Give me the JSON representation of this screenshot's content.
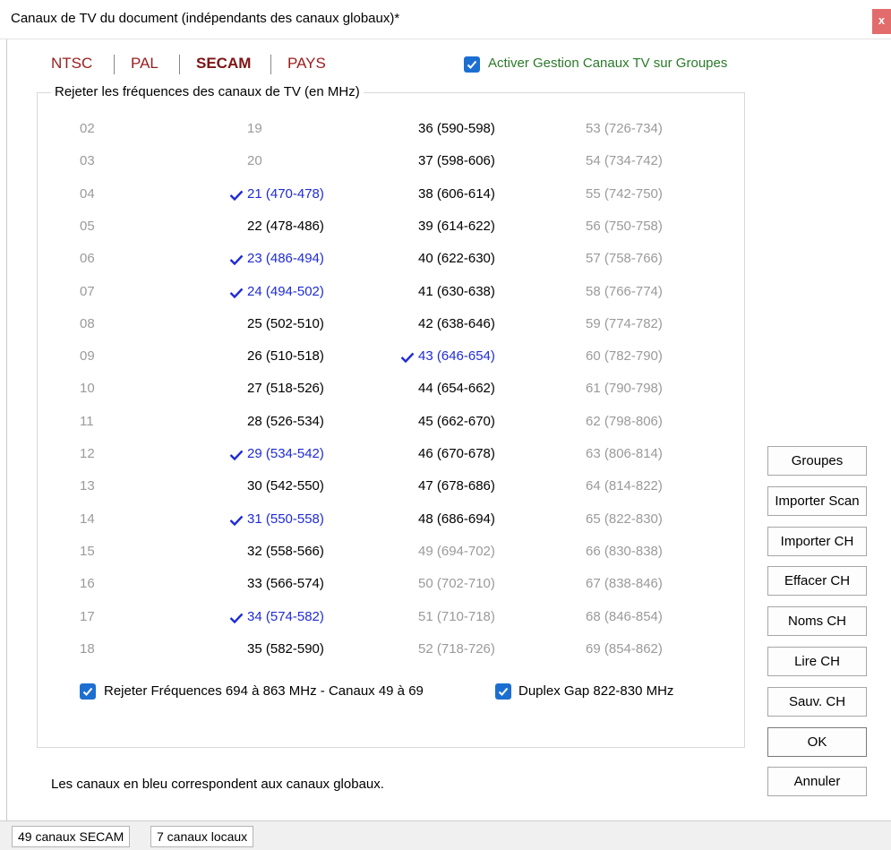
{
  "window": {
    "title": "Canaux de TV du document (indépendants des canaux globaux)*",
    "close_label": "x"
  },
  "standards": {
    "items": [
      {
        "label": "NTSC",
        "active": false
      },
      {
        "label": "PAL",
        "active": false
      },
      {
        "label": "SECAM",
        "active": true
      },
      {
        "label": "PAYS",
        "active": false
      }
    ]
  },
  "activer": {
    "label": "Activer Gestion Canaux TV sur Groupes",
    "checked": true
  },
  "group": {
    "legend": "Rejeter les fréquences des canaux de TV (en MHz)"
  },
  "channels": {
    "col1": [
      {
        "text": "02",
        "state": "na"
      },
      {
        "text": "03",
        "state": "na"
      },
      {
        "text": "04",
        "state": "na"
      },
      {
        "text": "05",
        "state": "na"
      },
      {
        "text": "06",
        "state": "na"
      },
      {
        "text": "07",
        "state": "na"
      },
      {
        "text": "08",
        "state": "na"
      },
      {
        "text": "09",
        "state": "na"
      },
      {
        "text": "10",
        "state": "na"
      },
      {
        "text": "11",
        "state": "na"
      },
      {
        "text": "12",
        "state": "na"
      },
      {
        "text": "13",
        "state": "na"
      },
      {
        "text": "14",
        "state": "na"
      },
      {
        "text": "15",
        "state": "na"
      },
      {
        "text": "16",
        "state": "na"
      },
      {
        "text": "17",
        "state": "na"
      },
      {
        "text": "18",
        "state": "na"
      }
    ],
    "col2": [
      {
        "text": "19",
        "state": "na"
      },
      {
        "text": "20",
        "state": "na"
      },
      {
        "text": "21 (470-478)",
        "state": "global",
        "checked": true
      },
      {
        "text": "22 (478-486)",
        "state": "local"
      },
      {
        "text": "23 (486-494)",
        "state": "global",
        "checked": true
      },
      {
        "text": "24 (494-502)",
        "state": "global",
        "checked": true
      },
      {
        "text": "25 (502-510)",
        "state": "local"
      },
      {
        "text": "26 (510-518)",
        "state": "local"
      },
      {
        "text": "27 (518-526)",
        "state": "local"
      },
      {
        "text": "28 (526-534)",
        "state": "local"
      },
      {
        "text": "29 (534-542)",
        "state": "global",
        "checked": true
      },
      {
        "text": "30 (542-550)",
        "state": "local"
      },
      {
        "text": "31 (550-558)",
        "state": "global",
        "checked": true
      },
      {
        "text": "32 (558-566)",
        "state": "local"
      },
      {
        "text": "33 (566-574)",
        "state": "local"
      },
      {
        "text": "34 (574-582)",
        "state": "global",
        "checked": true
      },
      {
        "text": "35 (582-590)",
        "state": "local"
      }
    ],
    "col3": [
      {
        "text": "36 (590-598)",
        "state": "local"
      },
      {
        "text": "37 (598-606)",
        "state": "local"
      },
      {
        "text": "38 (606-614)",
        "state": "local"
      },
      {
        "text": "39 (614-622)",
        "state": "local"
      },
      {
        "text": "40 (622-630)",
        "state": "local"
      },
      {
        "text": "41 (630-638)",
        "state": "local"
      },
      {
        "text": "42 (638-646)",
        "state": "local"
      },
      {
        "text": "43 (646-654)",
        "state": "global",
        "checked": true
      },
      {
        "text": "44 (654-662)",
        "state": "local"
      },
      {
        "text": "45 (662-670)",
        "state": "local"
      },
      {
        "text": "46 (670-678)",
        "state": "local"
      },
      {
        "text": "47 (678-686)",
        "state": "local"
      },
      {
        "text": "48 (686-694)",
        "state": "local"
      },
      {
        "text": "49 (694-702)",
        "state": "na"
      },
      {
        "text": "50 (702-710)",
        "state": "na"
      },
      {
        "text": "51 (710-718)",
        "state": "na"
      },
      {
        "text": "52 (718-726)",
        "state": "na"
      }
    ],
    "col4": [
      {
        "text": "53 (726-734)",
        "state": "na"
      },
      {
        "text": "54 (734-742)",
        "state": "na"
      },
      {
        "text": "55 (742-750)",
        "state": "na"
      },
      {
        "text": "56 (750-758)",
        "state": "na"
      },
      {
        "text": "57 (758-766)",
        "state": "na"
      },
      {
        "text": "58 (766-774)",
        "state": "na"
      },
      {
        "text": "59 (774-782)",
        "state": "na"
      },
      {
        "text": "60 (782-790)",
        "state": "na"
      },
      {
        "text": "61 (790-798)",
        "state": "na"
      },
      {
        "text": "62 (798-806)",
        "state": "na"
      },
      {
        "text": "63 (806-814)",
        "state": "na"
      },
      {
        "text": "64 (814-822)",
        "state": "na"
      },
      {
        "text": "65 (822-830)",
        "state": "na"
      },
      {
        "text": "66 (830-838)",
        "state": "na"
      },
      {
        "text": "67 (838-846)",
        "state": "na"
      },
      {
        "text": "68 (846-854)",
        "state": "na"
      },
      {
        "text": "69 (854-862)",
        "state": "na"
      }
    ]
  },
  "options": {
    "reject_label": "Rejeter Fréquences 694 à 863 MHz - Canaux 49 à 69",
    "reject_checked": true,
    "duplex_label": "Duplex Gap 822-830 MHz",
    "duplex_checked": true
  },
  "note": "Les canaux en bleu correspondent aux canaux globaux.",
  "buttons": {
    "groupes": "Groupes",
    "importer_scan": "Importer Scan",
    "importer_ch": "Importer CH",
    "effacer_ch": "Effacer CH",
    "noms_ch": "Noms CH",
    "lire_ch": "Lire CH",
    "sauv_ch": "Sauv. CH",
    "ok": "OK",
    "annuler": "Annuler"
  },
  "status": {
    "secam_count": "49 canaux SECAM",
    "local_count": "7 canaux locaux"
  },
  "colors": {
    "global_channel": "#1f2bd6",
    "unavailable_channel": "#9a9a9a",
    "standard_tab": "#9b1c1c",
    "activer_label": "#2a7a2a",
    "checkbox": "#1c6fd1",
    "close_button": "#e26b6b"
  }
}
